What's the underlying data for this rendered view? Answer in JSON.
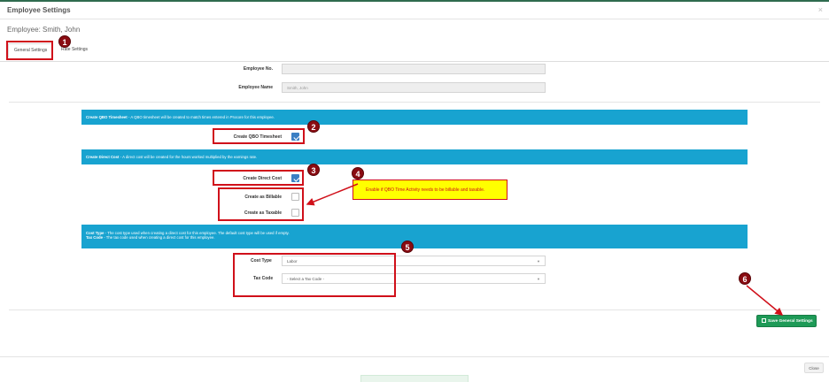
{
  "modal": {
    "title": "Employee Settings",
    "close_glyph": "×",
    "employee_label": "Employee: Smith, John"
  },
  "tabs": [
    {
      "label": "General Settings",
      "active": true
    },
    {
      "label": "Rate Settings",
      "active": false
    }
  ],
  "fields": {
    "employee_no": {
      "label": "Employee No.",
      "value": ""
    },
    "employee_name": {
      "label": "Employee Name",
      "value": "Smith, John"
    }
  },
  "banners": {
    "qbo_timesheet": {
      "title": "Create QBO Timesheet",
      "text": " - A QBO timesheet will be created to match times entered in Procore for this employee."
    },
    "direct_cost": {
      "title": "Create Direct Cost",
      "text": " - A direct cost will be created for the hours worked multiplied by the earnings rate."
    },
    "cost_type": {
      "title": "Cost Type",
      "text": " - The cost type used when creating a direct cost for this employee. The default cost type will be used if empty."
    },
    "tax_code": {
      "title": "Tax Code",
      "text": " - The tax code used when creating a direct cost for this employee."
    }
  },
  "checkboxes": {
    "create_qbo_timesheet": {
      "label": "Create QBO Timesheet",
      "checked": true
    },
    "create_direct_cost": {
      "label": "Create Direct Cost",
      "checked": true
    },
    "create_as_billable": {
      "label": "Create as Billable",
      "checked": false
    },
    "create_as_taxable": {
      "label": "Create as Taxable",
      "checked": false
    }
  },
  "selects": {
    "cost_type": {
      "label": "Cost Type",
      "value": "Labor"
    },
    "tax_code": {
      "label": "Tax Code",
      "value": "- Select a Tax Code -"
    }
  },
  "buttons": {
    "save": "Save General Settings",
    "close": "Close"
  },
  "annotations": {
    "markers": [
      "1",
      "2",
      "3",
      "4",
      "5",
      "6"
    ],
    "note": "Enable if QBO Time Activity needs to be billable and taxable."
  },
  "colors": {
    "banner": "#18a3d0",
    "save_button": "#1e9a57",
    "checkbox_checked": "#3b7fc4",
    "highlight": "#d0101a",
    "marker": "#8a0c12",
    "note_background": "#ffff00"
  }
}
